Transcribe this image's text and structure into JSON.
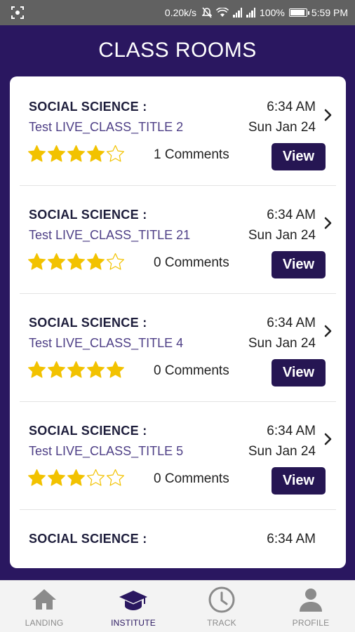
{
  "status_bar": {
    "speed": "0.20k/s",
    "battery": "100%",
    "battery_level": 1.0,
    "time": "5:59 PM"
  },
  "header": {
    "title": "CLASS ROOMS"
  },
  "classes": [
    {
      "subject": "SOCIAL SCIENCE :",
      "title": "Test LIVE_CLASS_TITLE 2",
      "time": "6:34 AM",
      "date": "Sun Jan 24",
      "rating": 4,
      "comments": "1 Comments",
      "view_label": "View"
    },
    {
      "subject": "SOCIAL SCIENCE :",
      "title": "Test LIVE_CLASS_TITLE 21",
      "time": "6:34 AM",
      "date": "Sun Jan 24",
      "rating": 4,
      "comments": "0 Comments",
      "view_label": "View"
    },
    {
      "subject": "SOCIAL SCIENCE :",
      "title": "Test LIVE_CLASS_TITLE 4",
      "time": "6:34 AM",
      "date": "Sun Jan 24",
      "rating": 5,
      "comments": "0 Comments",
      "view_label": "View"
    },
    {
      "subject": "SOCIAL SCIENCE :",
      "title": "Test LIVE_CLASS_TITLE 5",
      "time": "6:34 AM",
      "date": "Sun Jan 24",
      "rating": 3,
      "comments": "0 Comments",
      "view_label": "View"
    },
    {
      "subject": "SOCIAL SCIENCE :",
      "title": "",
      "time": "6:34 AM",
      "date": "",
      "rating": 0,
      "comments": "",
      "view_label": ""
    }
  ],
  "bottom_nav": [
    {
      "label": "LANDING",
      "icon": "home-icon",
      "active": false
    },
    {
      "label": "INSTITUTE",
      "icon": "graduation-cap-icon",
      "active": true
    },
    {
      "label": "TRACK",
      "icon": "clock-icon",
      "active": false
    },
    {
      "label": "PROFILE",
      "icon": "person-icon",
      "active": false
    }
  ],
  "colors": {
    "primary": "#2a1760",
    "button": "#261653",
    "star": "#f2c200",
    "title_text": "#4e3f86",
    "nav_inactive": "#8b8b8b"
  }
}
